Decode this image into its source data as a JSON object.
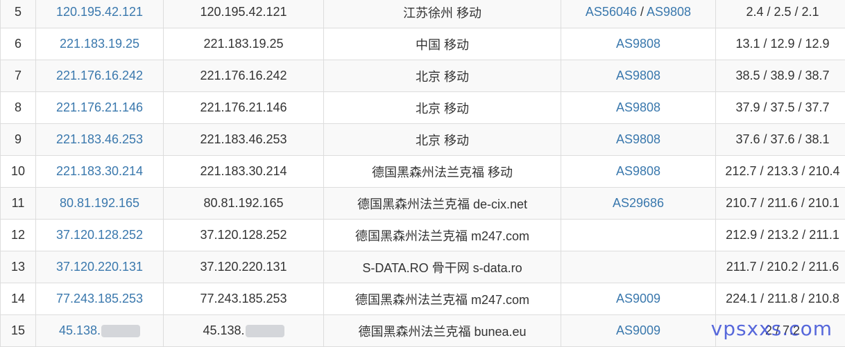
{
  "rows": [
    {
      "hop": "5",
      "ip": "120.195.42.121",
      "host": "120.195.42.121",
      "geo": "江苏徐州 移动",
      "as": [
        "AS56046",
        "AS9808"
      ],
      "rtt": "2.4 / 2.5 / 2.1"
    },
    {
      "hop": "6",
      "ip": "221.183.19.25",
      "host": "221.183.19.25",
      "geo": "中国 移动",
      "as": [
        "AS9808"
      ],
      "rtt": "13.1 / 12.9 / 12.9"
    },
    {
      "hop": "7",
      "ip": "221.176.16.242",
      "host": "221.176.16.242",
      "geo": "北京 移动",
      "as": [
        "AS9808"
      ],
      "rtt": "38.5 / 38.9 / 38.7"
    },
    {
      "hop": "8",
      "ip": "221.176.21.146",
      "host": "221.176.21.146",
      "geo": "北京 移动",
      "as": [
        "AS9808"
      ],
      "rtt": "37.9 / 37.5 / 37.7"
    },
    {
      "hop": "9",
      "ip": "221.183.46.253",
      "host": "221.183.46.253",
      "geo": "北京 移动",
      "as": [
        "AS9808"
      ],
      "rtt": "37.6 / 37.6 / 38.1"
    },
    {
      "hop": "10",
      "ip": "221.183.30.214",
      "host": "221.183.30.214",
      "geo": "德国黑森州法兰克福 移动",
      "as": [
        "AS9808"
      ],
      "rtt": "212.7 / 213.3 / 210.4"
    },
    {
      "hop": "11",
      "ip": "80.81.192.165",
      "host": "80.81.192.165",
      "geo": "德国黑森州法兰克福 de-cix.net",
      "as": [
        "AS29686"
      ],
      "rtt": "210.7 / 211.6 / 210.1"
    },
    {
      "hop": "12",
      "ip": "37.120.128.252",
      "host": "37.120.128.252",
      "geo": "德国黑森州法兰克福 m247.com",
      "as": [],
      "rtt": "212.9 / 213.2 / 211.1"
    },
    {
      "hop": "13",
      "ip": "37.120.220.131",
      "host": "37.120.220.131",
      "geo": "S-DATA.RO 骨干网 s-data.ro",
      "as": [],
      "rtt": "211.7 / 210.2 / 211.6"
    },
    {
      "hop": "14",
      "ip": "77.243.185.253",
      "host": "77.243.185.253",
      "geo": "德国黑森州法兰克福 m247.com",
      "as": [
        "AS9009"
      ],
      "rtt": "224.1 / 211.8 / 210.8"
    },
    {
      "hop": "15",
      "ip": "45.138.",
      "host": "45.138.",
      "geo": "德国黑森州法兰克福 bunea.eu",
      "as": [
        "AS9009"
      ],
      "rtt": "2 / 7.2",
      "masked": true
    }
  ],
  "watermark": "vpsxxs.com"
}
